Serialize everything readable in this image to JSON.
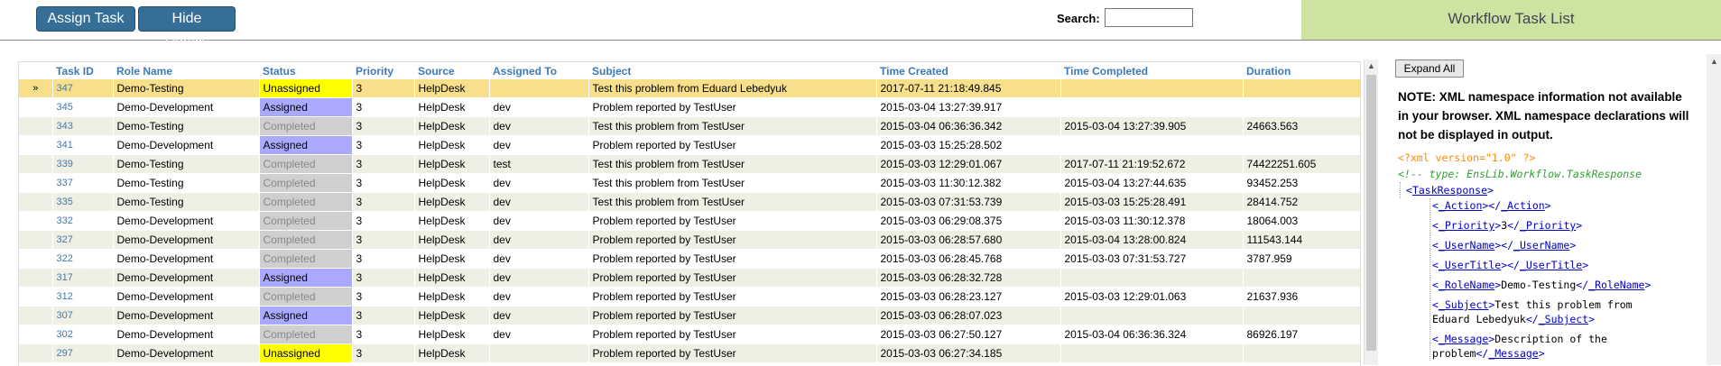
{
  "toolbar": {
    "assign_label": "Assign Task",
    "hide_label": "Hide Details",
    "search_label": "Search:",
    "search_value": ""
  },
  "title": "Workflow Task List",
  "grid": {
    "columns": [
      "Task ID",
      "Role Name",
      "Status",
      "Priority",
      "Source",
      "Assigned To",
      "Subject",
      "Time Created",
      "Time Completed",
      "Duration"
    ],
    "selected_marker": "»",
    "rows": [
      {
        "id": "347",
        "role": "Demo-Testing",
        "status": "Unassigned",
        "priority": "3",
        "source": "HelpDesk",
        "assigned": "",
        "subject": "Test this problem from Eduard Lebedyuk",
        "created": "2017-07-11 21:18:49.845",
        "completed": "",
        "duration": ""
      },
      {
        "id": "345",
        "role": "Demo-Development",
        "status": "Assigned",
        "priority": "3",
        "source": "HelpDesk",
        "assigned": "dev",
        "subject": "Problem reported by TestUser",
        "created": "2015-03-04 13:27:39.917",
        "completed": "",
        "duration": ""
      },
      {
        "id": "343",
        "role": "Demo-Testing",
        "status": "Completed",
        "priority": "3",
        "source": "HelpDesk",
        "assigned": "dev",
        "subject": "Test this problem from TestUser",
        "created": "2015-03-04 06:36:36.342",
        "completed": "2015-03-04 13:27:39.905",
        "duration": "24663.563"
      },
      {
        "id": "341",
        "role": "Demo-Development",
        "status": "Assigned",
        "priority": "3",
        "source": "HelpDesk",
        "assigned": "dev",
        "subject": "Problem reported by TestUser",
        "created": "2015-03-03 15:25:28.502",
        "completed": "",
        "duration": ""
      },
      {
        "id": "339",
        "role": "Demo-Testing",
        "status": "Completed",
        "priority": "3",
        "source": "HelpDesk",
        "assigned": "test",
        "subject": "Test this problem from TestUser",
        "created": "2015-03-03 12:29:01.067",
        "completed": "2017-07-11 21:19:52.672",
        "duration": "74422251.605"
      },
      {
        "id": "337",
        "role": "Demo-Testing",
        "status": "Completed",
        "priority": "3",
        "source": "HelpDesk",
        "assigned": "dev",
        "subject": "Test this problem from TestUser",
        "created": "2015-03-03 11:30:12.382",
        "completed": "2015-03-04 13:27:44.635",
        "duration": "93452.253"
      },
      {
        "id": "335",
        "role": "Demo-Testing",
        "status": "Completed",
        "priority": "3",
        "source": "HelpDesk",
        "assigned": "dev",
        "subject": "Test this problem from TestUser",
        "created": "2015-03-03 07:31:53.739",
        "completed": "2015-03-03 15:25:28.491",
        "duration": "28414.752"
      },
      {
        "id": "332",
        "role": "Demo-Development",
        "status": "Completed",
        "priority": "3",
        "source": "HelpDesk",
        "assigned": "dev",
        "subject": "Problem reported by TestUser",
        "created": "2015-03-03 06:29:08.375",
        "completed": "2015-03-03 11:30:12.378",
        "duration": "18064.003"
      },
      {
        "id": "327",
        "role": "Demo-Development",
        "status": "Completed",
        "priority": "3",
        "source": "HelpDesk",
        "assigned": "dev",
        "subject": "Problem reported by TestUser",
        "created": "2015-03-03 06:28:57.680",
        "completed": "2015-03-04 13:28:00.824",
        "duration": "111543.144"
      },
      {
        "id": "322",
        "role": "Demo-Development",
        "status": "Completed",
        "priority": "3",
        "source": "HelpDesk",
        "assigned": "dev",
        "subject": "Problem reported by TestUser",
        "created": "2015-03-03 06:28:45.768",
        "completed": "2015-03-03 07:31:53.727",
        "duration": "3787.959"
      },
      {
        "id": "317",
        "role": "Demo-Development",
        "status": "Assigned",
        "priority": "3",
        "source": "HelpDesk",
        "assigned": "dev",
        "subject": "Problem reported by TestUser",
        "created": "2015-03-03 06:28:32.728",
        "completed": "",
        "duration": ""
      },
      {
        "id": "312",
        "role": "Demo-Development",
        "status": "Completed",
        "priority": "3",
        "source": "HelpDesk",
        "assigned": "dev",
        "subject": "Problem reported by TestUser",
        "created": "2015-03-03 06:28:23.127",
        "completed": "2015-03-03 12:29:01.063",
        "duration": "21637.936"
      },
      {
        "id": "307",
        "role": "Demo-Development",
        "status": "Assigned",
        "priority": "3",
        "source": "HelpDesk",
        "assigned": "dev",
        "subject": "Problem reported by TestUser",
        "created": "2015-03-03 06:28:07.023",
        "completed": "",
        "duration": ""
      },
      {
        "id": "302",
        "role": "Demo-Development",
        "status": "Completed",
        "priority": "3",
        "source": "HelpDesk",
        "assigned": "dev",
        "subject": "Problem reported by TestUser",
        "created": "2015-03-03 06:27:50.127",
        "completed": "2015-03-04 06:36:36.324",
        "duration": "86926.197"
      },
      {
        "id": "297",
        "role": "Demo-Development",
        "status": "Unassigned",
        "priority": "3",
        "source": "HelpDesk",
        "assigned": "",
        "subject": "Problem reported by TestUser",
        "created": "2015-03-03 06:27:34.185",
        "completed": "",
        "duration": ""
      }
    ]
  },
  "details": {
    "expand_label": "Expand All",
    "note": "NOTE: XML namespace information not available in your browser. XML namespace declarations will not be displayed in output.",
    "xml_decl": "<?xml version=\"1.0\" ?>",
    "xml_comment": "<!-- type: EnsLib.Workflow.TaskResponse",
    "root_tag": "TaskResponse",
    "elements": [
      {
        "name": "_Action",
        "value": ""
      },
      {
        "name": "_Priority",
        "value": "3"
      },
      {
        "name": "_UserName",
        "value": ""
      },
      {
        "name": "_UserTitle",
        "value": ""
      },
      {
        "name": "_RoleName",
        "value": "Demo-Testing"
      },
      {
        "name": "_Subject",
        "value": "Test this problem from Eduard Lebedyuk"
      },
      {
        "name": "_Message",
        "value": "Description of the problem"
      }
    ]
  },
  "colors": {
    "unassigned": "#ffff00",
    "assigned": "#a9a9ff",
    "completed": "#cfcfcf",
    "selected_row": "#f7df8c",
    "alt_row": "#efefe4",
    "header_text": "#3d7ab8",
    "button": "#356e96",
    "title_bg": "#cde3a1"
  }
}
